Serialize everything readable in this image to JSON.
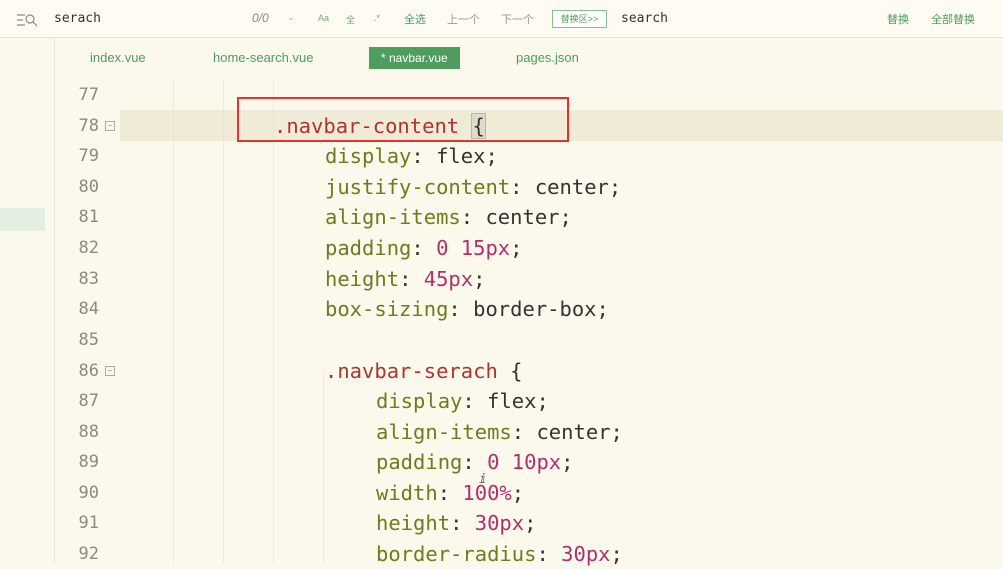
{
  "search": {
    "find_value": "serach",
    "match_count": "0/0",
    "opt_case": "Aa",
    "opt_word": "全",
    "opt_regex": ".*",
    "select_all": "全选",
    "prev": "上一个",
    "next": "下一个",
    "replace_toggle": "替换区>>",
    "replace_value": "search",
    "replace": "替换",
    "replace_all": "全部替换"
  },
  "tabs": [
    {
      "label": "index.vue"
    },
    {
      "label": "home-search.vue"
    },
    {
      "label": "* navbar.vue"
    },
    {
      "label": "pages.json"
    }
  ],
  "editor": {
    "lines": [
      {
        "n": "77"
      },
      {
        "n": "78",
        "sel": ".navbar-content",
        "rest": " ",
        "brace": "{"
      },
      {
        "n": "79",
        "prop": "display",
        "val": " flex;"
      },
      {
        "n": "80",
        "prop": "justify-content",
        "val": " center;"
      },
      {
        "n": "81",
        "prop": "align-items",
        "val": " center;"
      },
      {
        "n": "82",
        "prop": "padding",
        "num1": "0",
        "num2": "15px",
        "tail": ";"
      },
      {
        "n": "83",
        "prop": "height",
        "num2": "45px",
        "tail": ";"
      },
      {
        "n": "84",
        "prop": "box-sizing",
        "val": " border-box;"
      },
      {
        "n": "85"
      },
      {
        "n": "86",
        "sel": ".navbar-serach",
        "rest": " {"
      },
      {
        "n": "87",
        "prop": "display",
        "val": " flex;"
      },
      {
        "n": "88",
        "prop": "align-items",
        "val": " center;"
      },
      {
        "n": "89",
        "prop": "padding",
        "num1": "0",
        "num2": "10px",
        "tail": ";"
      },
      {
        "n": "90",
        "prop": "width",
        "num2": "100%",
        "tail": ";"
      },
      {
        "n": "91",
        "prop": "height",
        "num2": "30px",
        "tail": ";"
      },
      {
        "n": "92",
        "prop": "border-radius",
        "num2": "30px",
        "tail": ";"
      }
    ]
  },
  "colors": {
    "accent": "#4f9c5f",
    "selector": "#b0332f",
    "property": "#6e7b1e",
    "number": "#b0306e",
    "annotation": "#e5322d"
  }
}
